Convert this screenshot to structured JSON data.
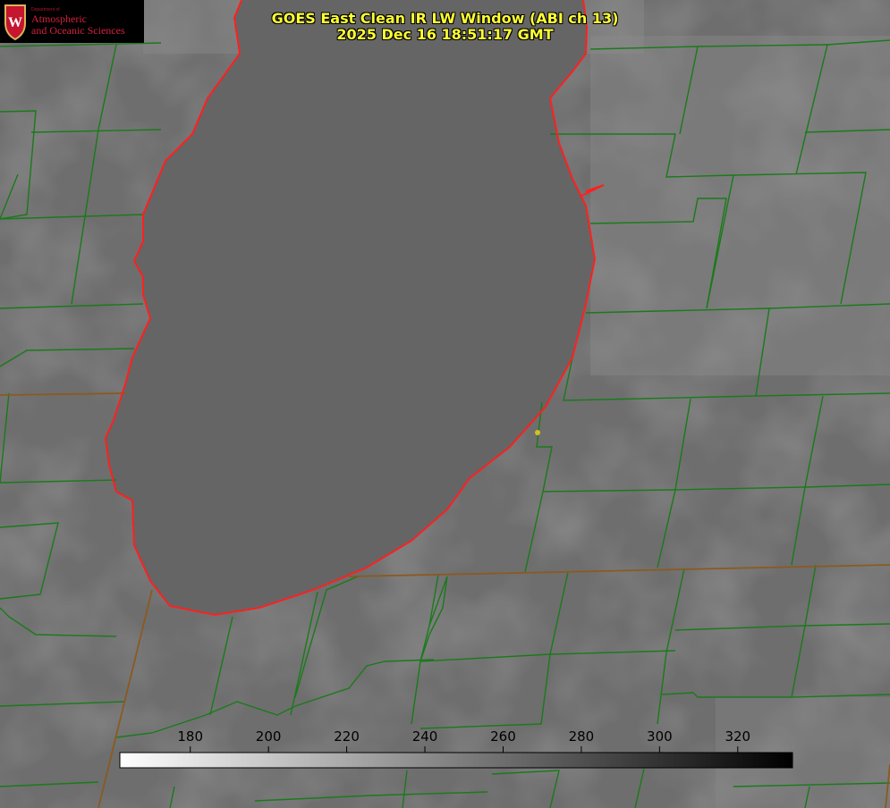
{
  "title_line1": "GOES East Clean IR LW Window (ABI ch 13)",
  "title_line2": "2025 Dec 16 18:51:17 GMT",
  "logo": {
    "department": "Department of",
    "line1": "Atmospheric",
    "line2": "and Oceanic Sciences",
    "emblem": "uw-crest-icon"
  },
  "colorbar": {
    "ticks": [
      "180",
      "200",
      "220",
      "240",
      "260",
      "280",
      "300",
      "320"
    ],
    "range": [
      162,
      334
    ]
  },
  "colors": {
    "county_lines": "#1a7a1a",
    "state_lines": "#8a5a20",
    "shoreline": "#ff2020",
    "title": "#ffff33",
    "marker": "#d4c020"
  }
}
